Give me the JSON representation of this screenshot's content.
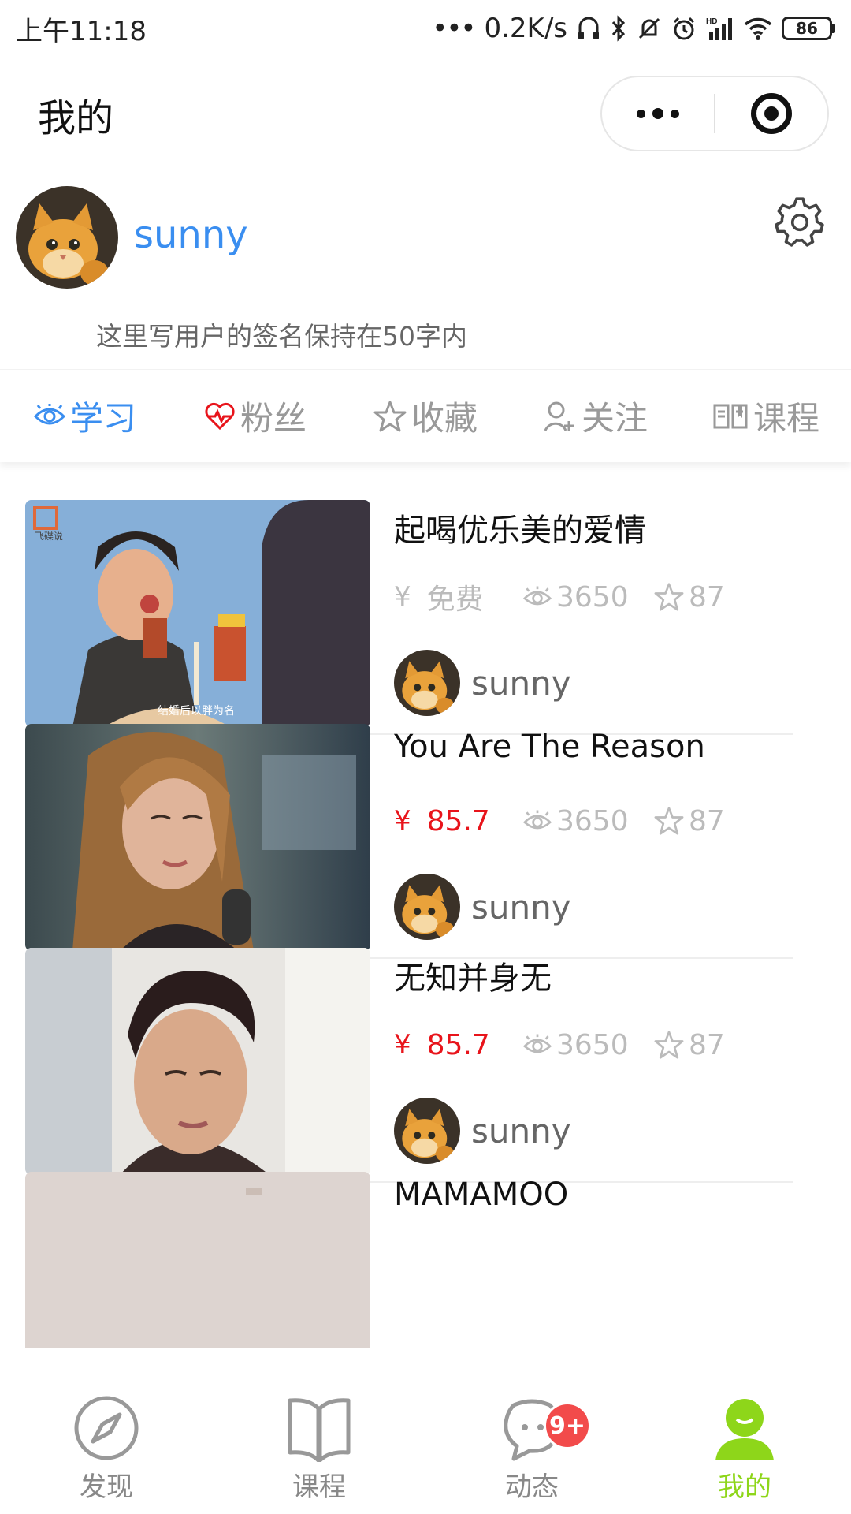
{
  "status_bar": {
    "time": "上午11:18",
    "speed": "0.2K/s",
    "battery": "86",
    "network": "HD"
  },
  "nav": {
    "title": "我的"
  },
  "profile": {
    "username": "sunny",
    "signature": "这里写用户的签名保持在50字内"
  },
  "tabs": [
    {
      "label": "学习",
      "icon": "eye-icon",
      "active": true
    },
    {
      "label": "粉丝",
      "icon": "heart-pulse-icon",
      "active": false
    },
    {
      "label": "收藏",
      "icon": "star-icon",
      "active": false
    },
    {
      "label": "关注",
      "icon": "add-user-icon",
      "active": false
    },
    {
      "label": "课程",
      "icon": "book-icon",
      "active": false
    }
  ],
  "currency_symbol": "¥",
  "courses": [
    {
      "title": "起喝优乐美的爱情",
      "price": "免费",
      "paid": false,
      "views": "3650",
      "stars": "87",
      "author": "sunny",
      "thumb_caption": "结婚后以胖为名",
      "thumb_logo": "飞碟说"
    },
    {
      "title": "You Are The Reason",
      "price": "85.7",
      "paid": true,
      "views": "3650",
      "stars": "87",
      "author": "sunny"
    },
    {
      "title": "无知并身无",
      "price": "85.7",
      "paid": true,
      "views": "3650",
      "stars": "87",
      "author": "sunny"
    },
    {
      "title": "MAMAMOO",
      "price": "",
      "paid": true,
      "views": "",
      "stars": "",
      "author": ""
    }
  ],
  "bottom_nav": [
    {
      "label": "发现",
      "icon": "compass-icon",
      "active": false
    },
    {
      "label": "课程",
      "icon": "book-icon",
      "active": false
    },
    {
      "label": "动态",
      "icon": "chat-bubble-icon",
      "active": false,
      "badge": "9+"
    },
    {
      "label": "我的",
      "icon": "user-icon",
      "active": true
    }
  ],
  "colors": {
    "accent_blue": "#3a8ef0",
    "price_red": "#e8141b",
    "active_green": "#8ed61a",
    "badge_red": "#f24b4b"
  }
}
